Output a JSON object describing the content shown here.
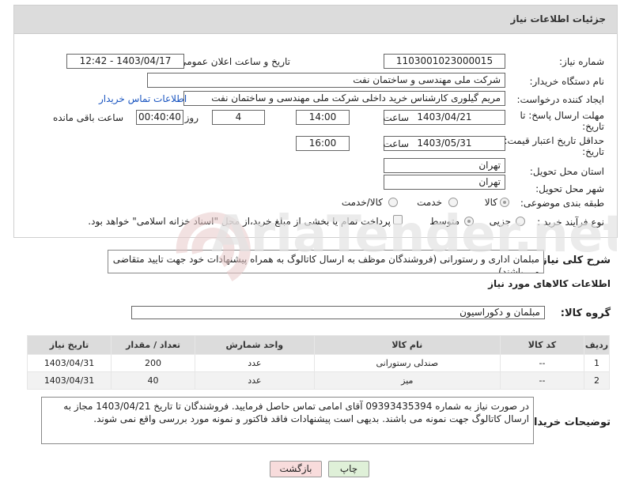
{
  "header": {
    "title": "جزئیات اطلاعات نیاز"
  },
  "fields": {
    "need_number_label": "شماره نیاز:",
    "need_number": "1103001023000015",
    "announce_label": "تاریخ و ساعت اعلان عمومی:",
    "announce_value": "1403/04/17 - 12:42",
    "buyer_org_label": "نام دستگاه خریدار:",
    "buyer_org": "شرکت ملی مهندسی و ساختمان نفت",
    "creator_label": "ایجاد کننده درخواست:",
    "creator": "مریم گیلوری کارشناس خرید داخلی شرکت ملی مهندسی و ساختمان نفت",
    "contact_link": "اطلاعات تماس خریدار",
    "deadline_label_1": "مهلت ارسال پاسخ: تا",
    "deadline_label_2": "تاریخ:",
    "deadline_date": "1403/04/21",
    "time_label": "ساعت",
    "deadline_time": "14:00",
    "days_value": "4",
    "days_label": "روز و",
    "remaining_time": "00:40:40",
    "remaining_label": "ساعت باقی مانده",
    "validity_label_1": "حداقل تاریخ اعتبار قیمت: تا",
    "validity_label_2": "تاریخ:",
    "validity_date": "1403/05/31",
    "validity_time": "16:00",
    "province_label": "استان محل تحویل:",
    "province": "تهران",
    "city_label": "شهر محل تحویل:",
    "city": "تهران",
    "category_label": "طبقه بندی موضوعی:",
    "category_options": [
      "کالا",
      "خدمت",
      "کالا/خدمت"
    ],
    "category_selected": "کالا",
    "process_label": "نوع فرآیند خرید :",
    "process_options": [
      "جزیی",
      "متوسط"
    ],
    "process_selected": "جزیی",
    "payment_note": "پرداخت تمام یا بخشی از مبلغ خرید،از محل \"اسناد خزانه اسلامی\" خواهد بود."
  },
  "description": {
    "label": "شرح کلی نیاز:",
    "text": "مبلمان اداری و رستورانی (فروشندگان موظف به ارسال کاتالوگ به همراه پیشنهادات خود جهت تایید متقاضی می باشند)."
  },
  "goods": {
    "section_title": "اطلاعات کالاهای مورد نیاز",
    "group_label": "گروه کالا:",
    "group_value": "مبلمان و دکوراسیون",
    "columns": [
      "ردیف",
      "کد کالا",
      "نام کالا",
      "واحد شمارش",
      "تعداد / مقدار",
      "تاریخ نیاز"
    ],
    "rows": [
      [
        "1",
        "--",
        "صندلی رستورانی",
        "عدد",
        "200",
        "1403/04/31"
      ],
      [
        "2",
        "--",
        "میز",
        "عدد",
        "40",
        "1403/04/31"
      ]
    ]
  },
  "buyer_notes": {
    "label": "توضیحات خریدار:",
    "text": "در صورت نیاز به شماره 09393435394 آقای امامی تماس حاصل فرمایید. فروشندگان تا تاریخ 1403/04/21 مجاز به ارسال کاتالوگ جهت نمونه می باشند. بدیهی است پیشنهادات فاقد فاکتور و نمونه مورد بررسی واقع نمی شوند."
  },
  "buttons": {
    "print": "چاپ",
    "back": "بازگشت"
  },
  "watermark": {
    "text": "AriaTender.net"
  },
  "colors": {
    "link": "#1a55c0",
    "print_btn": "#dff0d8",
    "back_btn": "#f8dcdc",
    "header_bg": "#dcdcdc"
  }
}
